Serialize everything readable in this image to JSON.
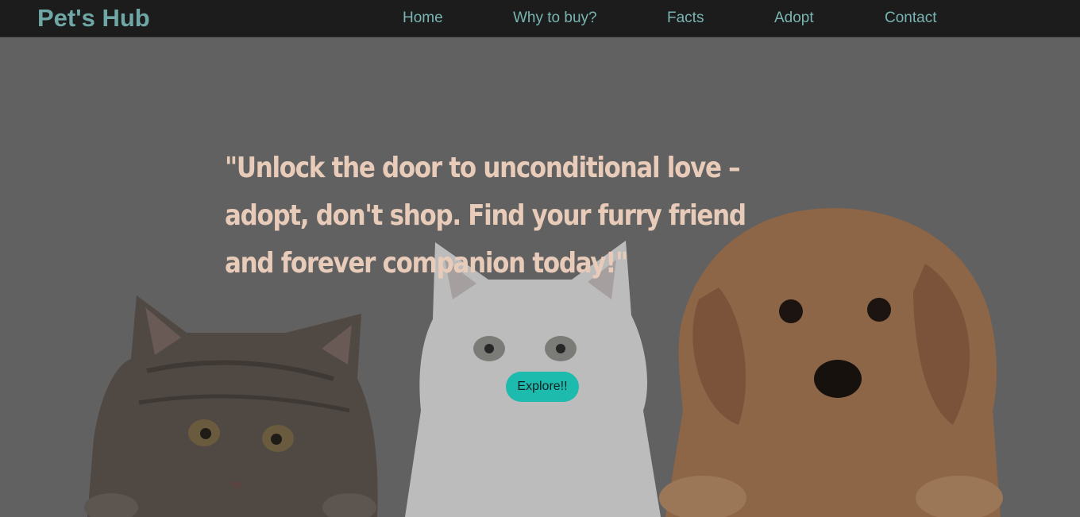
{
  "navbar": {
    "logo": "Pet's Hub",
    "links": [
      {
        "label": "Home"
      },
      {
        "label": "Why to buy?"
      },
      {
        "label": "Facts"
      },
      {
        "label": "Adopt"
      },
      {
        "label": "Contact"
      }
    ]
  },
  "hero": {
    "quote": "\"Unlock the door to unconditional love – adopt, don't shop. Find your furry friend and forever companion today!\"",
    "explore_label": "Explore!!",
    "image_subjects": [
      "tabby-kitten",
      "white-kitten",
      "golden-puppy"
    ]
  },
  "colors": {
    "navbar_bg": "#1c1c1c",
    "logo": "#6fa7a6",
    "nav_link": "#79b4b3",
    "hero_overlay": "#616161",
    "quote_text": "#e9cbb9",
    "button_bg": "#1dbaae"
  }
}
